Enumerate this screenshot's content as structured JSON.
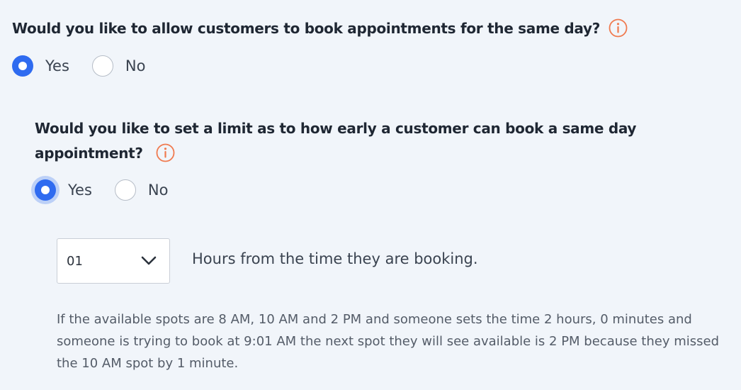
{
  "same_day": {
    "question": "Would you like to allow customers to book appointments for the same day?",
    "options": [
      {
        "label": "Yes",
        "selected": true
      },
      {
        "label": "No",
        "selected": false
      }
    ]
  },
  "limit": {
    "question": "Would you like to set a limit as to how early a customer can book a same day appointment?",
    "options": [
      {
        "label": "Yes",
        "selected": true
      },
      {
        "label": "No",
        "selected": false
      }
    ],
    "hours_select": {
      "value": "01"
    },
    "hours_suffix": "Hours from the time they are booking.",
    "explanation": "If the available spots are 8 AM, 10 AM and 2 PM and someone sets the time 2 hours, 0 minutes and someone is trying to book at 9:01 AM the next spot they will see available is 2 PM because they missed the 10 AM spot by 1 minute."
  },
  "icons": {
    "info": "info-circle-icon",
    "chevron": "chevron-down-icon"
  },
  "colors": {
    "accent": "#2f6bf0",
    "info_icon": "#f07a4f",
    "background": "#f1f5fa"
  }
}
